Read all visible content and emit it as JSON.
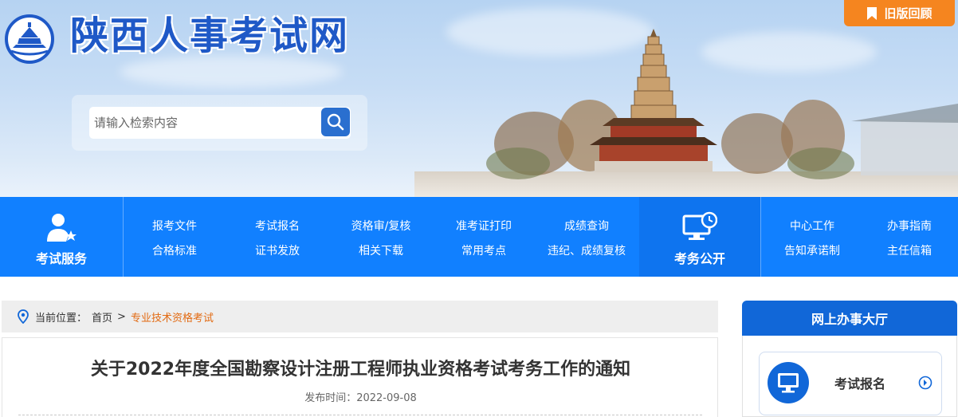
{
  "header": {
    "site_title": "陕西人事考试网",
    "old_version_label": "旧版回顾"
  },
  "search": {
    "placeholder": "请输入检索内容"
  },
  "nav": {
    "exam_service_label": "考试服务",
    "exam_affairs_label": "考务公开",
    "links_row1": [
      "报考文件",
      "考试报名",
      "资格审/复核",
      "准考证打印",
      "成绩查询"
    ],
    "links_row2": [
      "合格标准",
      "证书发放",
      "相关下载",
      "常用考点",
      "违纪、成绩复核"
    ],
    "right_row1": [
      "中心工作",
      "办事指南"
    ],
    "right_row2": [
      "告知承诺制",
      "主任信箱"
    ]
  },
  "breadcrumb": {
    "prefix": "当前位置：",
    "home": "首页",
    "separator": ">",
    "current": "专业技术资格考试"
  },
  "article": {
    "title": "关于2022年度全国勘察设计注册工程师执业资格考试考务工作的通知",
    "date_label": "发布时间：",
    "date": "2022-09-08"
  },
  "side_panel": {
    "title": "网上办事大厅",
    "card_label": "考试报名"
  },
  "colors": {
    "nav_blue": "#1180ff",
    "title_blue": "#1f59c7",
    "orange": "#f5851f",
    "crumb_current": "#e26a12"
  }
}
